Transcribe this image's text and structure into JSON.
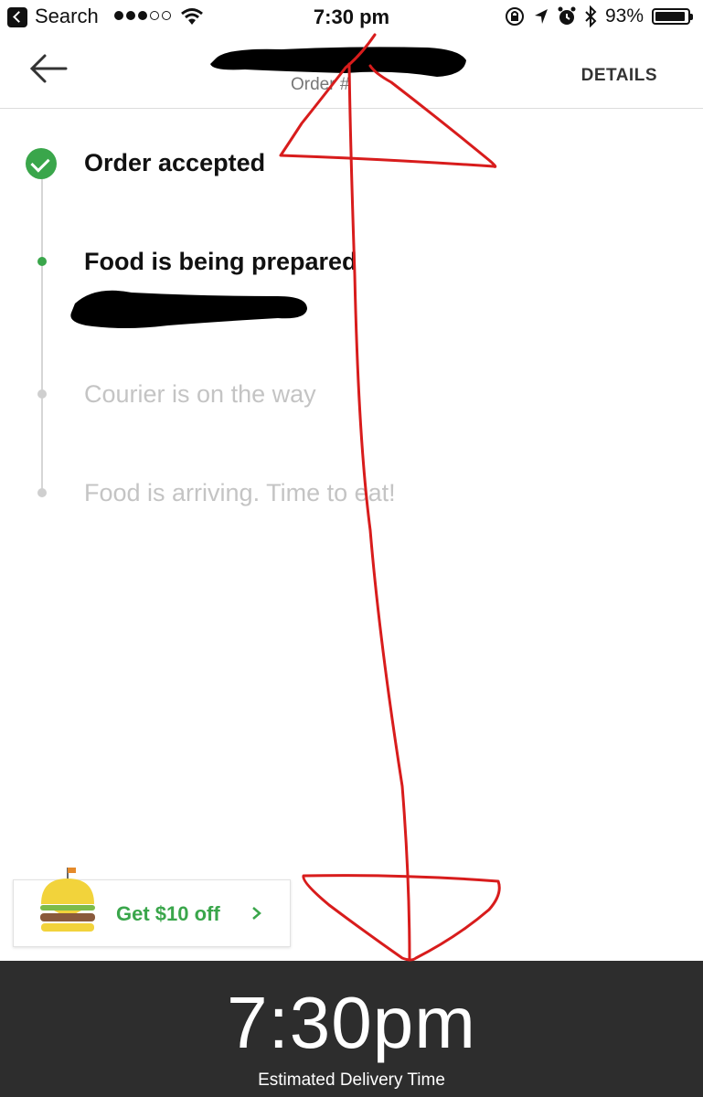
{
  "status_bar": {
    "back_label": "Search",
    "time": "7:30 pm",
    "battery": "93%",
    "battery_level": 0.93,
    "icons": [
      "back-chevron-icon",
      "signal-dots-icon",
      "wifi-icon",
      "orientation-lock-icon",
      "location-arrow-icon",
      "alarm-icon",
      "bluetooth-icon",
      "battery-icon"
    ]
  },
  "header": {
    "order_label": "Order #",
    "details_label": "DETAILS",
    "back_icon": "back-arrow-icon"
  },
  "timeline": {
    "steps": [
      {
        "label": "Order accepted",
        "state": "done"
      },
      {
        "label": "Food is being prepared",
        "state": "active"
      },
      {
        "label": "Courier is on the way",
        "state": "pending"
      },
      {
        "label": "Food is arriving. Time to eat!",
        "state": "pending"
      }
    ]
  },
  "promo": {
    "label": "Get $10 off",
    "icon": "burger-icon",
    "chevron_icon": "chevron-right-icon"
  },
  "footer": {
    "eta_time": "7:30pm",
    "eta_label": "Estimated Delivery Time"
  },
  "colors": {
    "accent_green": "#3aa64b",
    "footer_bg": "#2d2d2d",
    "annotation_red": "#d81c1c",
    "pending_gray": "#c4c4c4"
  }
}
